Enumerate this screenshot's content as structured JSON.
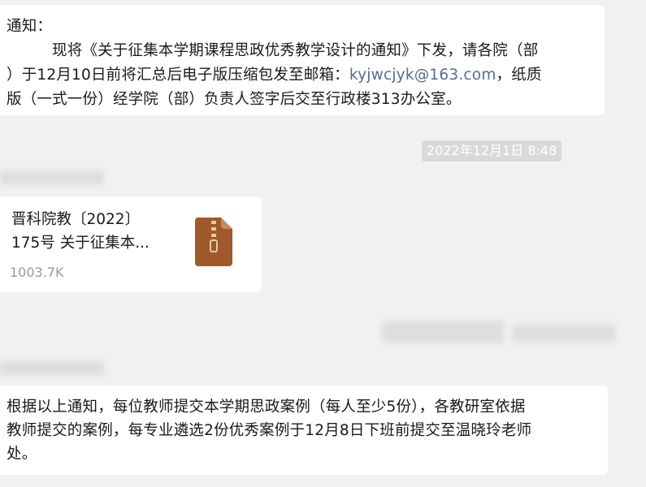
{
  "messages": [
    {
      "lines": [
        "通知：",
        "现将《关于征集本学期课程思政优秀教学设计的通知》下发，请各院（部",
        "）于12月10日前将汇总后电子版压缩包发至邮箱："
      ],
      "email": "kyjwcjyk@163.com",
      "line3_tail": "，纸质",
      "line4": "版（一式一份）经学院（部）负责人签字后交至行政楼313办公室。"
    }
  ],
  "timestamp": "2022年12月1日 8:48",
  "file": {
    "title_line1": "晋科院教〔2022〕",
    "title_line2": "175号 关于征集本...",
    "size": "1003.7K",
    "icon": "zip-file-icon",
    "icon_color": "#a0592a"
  },
  "message3": {
    "lines": [
      "根据以上通知，每位教师提交本学期思政案例（每人至少5份），各教研室依据",
      "教师提交的案例，每专业遴选2份优秀案例于12月8日下班前提交至温晓玲老师",
      "处。"
    ]
  },
  "colors": {
    "background": "#f1f1f1",
    "bubble": "#ffffff",
    "link": "#576b95",
    "timestamp_bg": "#d9d9d9"
  }
}
